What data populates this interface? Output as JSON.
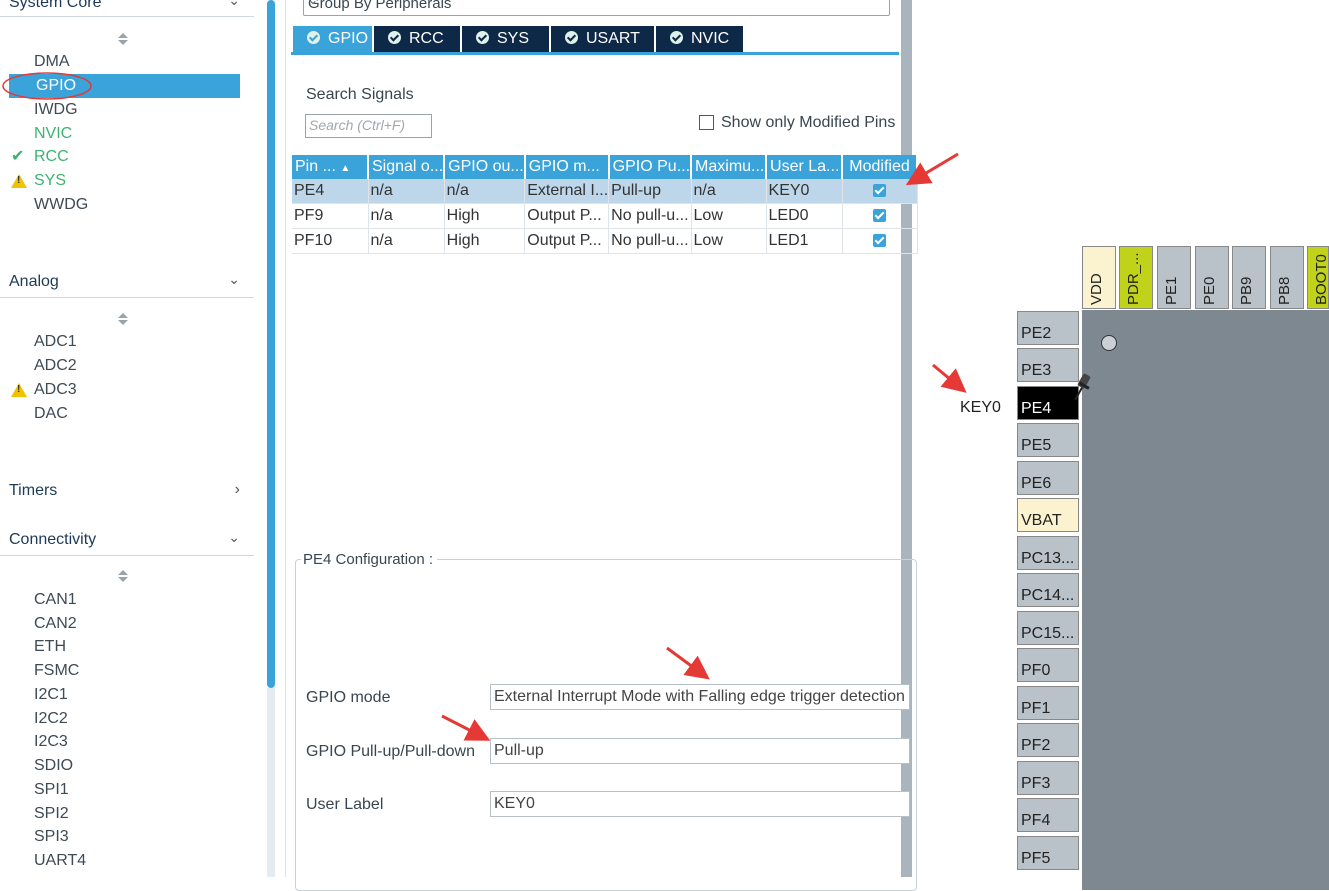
{
  "left_panel": {
    "system_core": {
      "header": "System Core",
      "items": [
        {
          "label": "DMA",
          "status": "none"
        },
        {
          "label": "GPIO",
          "status": "selected"
        },
        {
          "label": "IWDG",
          "status": "none"
        },
        {
          "label": "NVIC",
          "status": "green"
        },
        {
          "label": "RCC",
          "status": "ok"
        },
        {
          "label": "SYS",
          "status": "warning"
        },
        {
          "label": "WWDG",
          "status": "none"
        }
      ]
    },
    "analog": {
      "header": "Analog",
      "items": [
        {
          "label": "ADC1"
        },
        {
          "label": "ADC2"
        },
        {
          "label": "ADC3",
          "status": "warning"
        },
        {
          "label": "DAC"
        }
      ]
    },
    "timers": {
      "header": "Timers"
    },
    "connectivity": {
      "header": "Connectivity",
      "items": [
        "CAN1",
        "CAN2",
        "ETH",
        "FSMC",
        "I2C1",
        "I2C2",
        "I2C3",
        "SDIO",
        "SPI1",
        "SPI2",
        "SPI3",
        "UART4"
      ]
    }
  },
  "middle": {
    "group_by": "Group By Peripherals",
    "tabs": [
      "GPIO",
      "RCC",
      "SYS",
      "USART",
      "NVIC"
    ],
    "active_tab": "GPIO",
    "search_label": "Search Signals",
    "search_placeholder": "Search (Ctrl+F)",
    "show_modified_label": "Show only Modified Pins",
    "table": {
      "headers": [
        "Pin ...",
        "Signal o...",
        "GPIO ou...",
        "GPIO m...",
        "GPIO Pu...",
        "Maximu...",
        "User La...",
        "Modified"
      ],
      "rows": [
        [
          "PE4",
          "n/a",
          "n/a",
          "External I...",
          "Pull-up",
          "n/a",
          "KEY0"
        ],
        [
          "PF9",
          "n/a",
          "High",
          "Output P...",
          "No pull-u...",
          "Low",
          "LED0"
        ],
        [
          "PF10",
          "n/a",
          "High",
          "Output P...",
          "No pull-u...",
          "Low",
          "LED1"
        ]
      ]
    },
    "config": {
      "title": "PE4 Configuration :",
      "gpio_mode_label": "GPIO mode",
      "gpio_mode_value": "External Interrupt Mode with Falling edge trigger detection",
      "pull_label": "GPIO Pull-up/Pull-down",
      "pull_value": "Pull-up",
      "user_label_label": "User Label",
      "user_label_value": "KEY0"
    }
  },
  "chip_view": {
    "top_pins": [
      "VDD",
      "PDR_...",
      "PE1",
      "PE0",
      "PB9",
      "PB8",
      "BOOT0"
    ],
    "left_pins": [
      "PE2",
      "PE3",
      "PE4",
      "PE5",
      "PE6",
      "VBAT",
      "PC13...",
      "PC14...",
      "PC15...",
      "PF0",
      "PF1",
      "PF2",
      "PF3",
      "PF4",
      "PF5"
    ],
    "selected_pin": "PE4",
    "pin_label": "KEY0"
  },
  "colors": {
    "accent": "#3aa3d9",
    "tab_dark": "#0e2847",
    "green": "#3db370",
    "annotation_red": "#e53935"
  }
}
